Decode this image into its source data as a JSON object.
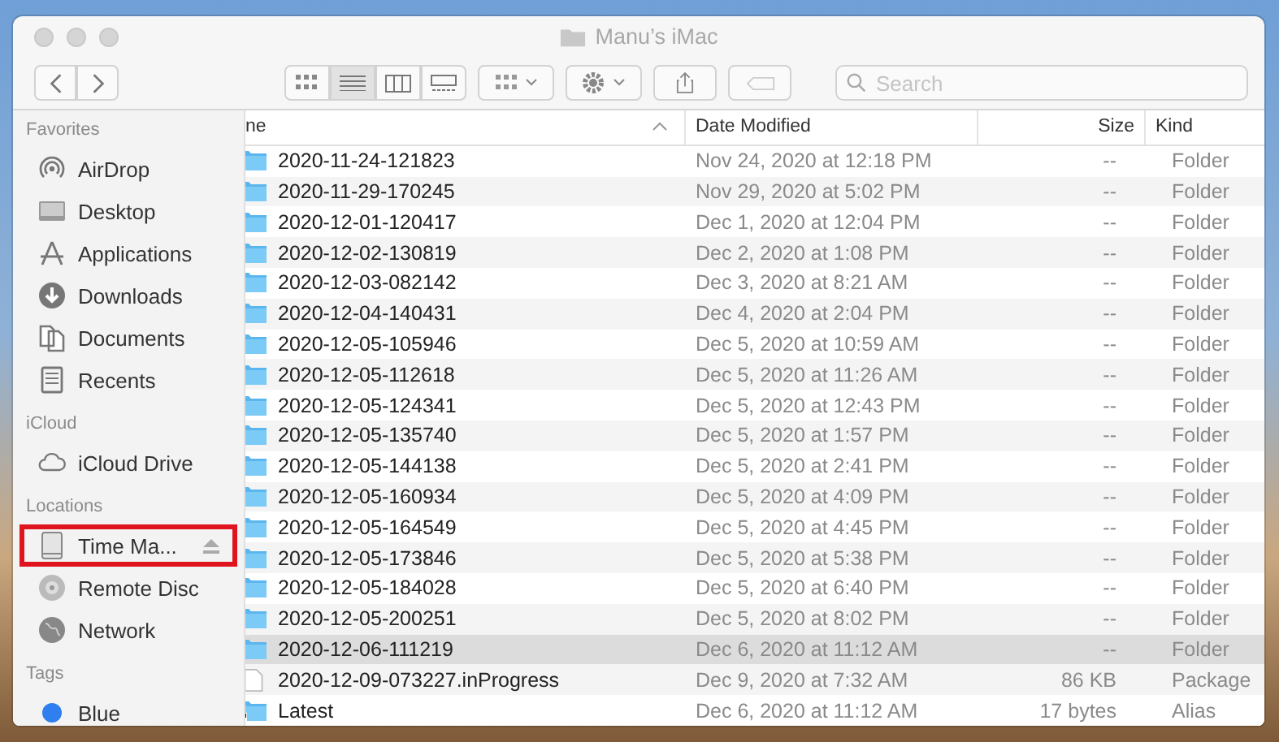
{
  "window": {
    "title": "Manu’s iMac"
  },
  "toolbar": {
    "view_modes": [
      {
        "kind": "icons",
        "selected": false
      },
      {
        "kind": "list",
        "selected": true
      },
      {
        "kind": "columns",
        "selected": false
      },
      {
        "kind": "gallery",
        "selected": false
      }
    ],
    "search": {
      "placeholder": "Search"
    }
  },
  "sidebar": {
    "sections": [
      {
        "title": "Favorites",
        "items": [
          {
            "label": "AirDrop",
            "kind": "airdrop",
            "highlighted": false
          },
          {
            "label": "Desktop",
            "kind": "desktop",
            "highlighted": false
          },
          {
            "label": "Applications",
            "kind": "applications",
            "highlighted": false
          },
          {
            "label": "Downloads",
            "kind": "downloads",
            "highlighted": false
          },
          {
            "label": "Documents",
            "kind": "documents",
            "highlighted": false
          },
          {
            "label": "Recents",
            "kind": "recents",
            "highlighted": false
          }
        ]
      },
      {
        "title": "iCloud",
        "items": [
          {
            "label": "iCloud Drive",
            "kind": "cloud",
            "highlighted": false
          }
        ]
      },
      {
        "title": "Locations",
        "items": [
          {
            "label": "Time Ma...",
            "kind": "disk",
            "highlighted": true,
            "eject": true
          },
          {
            "label": "Remote Disc",
            "kind": "disc",
            "highlighted": false
          },
          {
            "label": "Network",
            "kind": "globe",
            "highlighted": false
          }
        ]
      },
      {
        "title": "Tags",
        "items": [
          {
            "label": "Blue",
            "kind": "tag",
            "color": "#2f7ff0",
            "highlighted": false
          }
        ]
      }
    ]
  },
  "table": {
    "columns": [
      {
        "label": "ne",
        "sorted": true
      },
      {
        "label": "Date Modified",
        "sorted": false
      },
      {
        "label": "Size",
        "sorted": false
      },
      {
        "label": "Kind",
        "sorted": false
      }
    ],
    "rows": [
      {
        "kind": "folder",
        "name": "2020-11-24-121823",
        "date": "Nov 24, 2020 at 12:18 PM",
        "size": "--",
        "type": "Folder",
        "selected": false
      },
      {
        "kind": "folder",
        "name": "2020-11-29-170245",
        "date": "Nov 29, 2020 at 5:02 PM",
        "size": "--",
        "type": "Folder",
        "selected": false
      },
      {
        "kind": "folder",
        "name": "2020-12-01-120417",
        "date": "Dec 1, 2020 at 12:04 PM",
        "size": "--",
        "type": "Folder",
        "selected": false
      },
      {
        "kind": "folder",
        "name": "2020-12-02-130819",
        "date": "Dec 2, 2020 at 1:08 PM",
        "size": "--",
        "type": "Folder",
        "selected": false
      },
      {
        "kind": "folder",
        "name": "2020-12-03-082142",
        "date": "Dec 3, 2020 at 8:21 AM",
        "size": "--",
        "type": "Folder",
        "selected": false
      },
      {
        "kind": "folder",
        "name": "2020-12-04-140431",
        "date": "Dec 4, 2020 at 2:04 PM",
        "size": "--",
        "type": "Folder",
        "selected": false
      },
      {
        "kind": "folder",
        "name": "2020-12-05-105946",
        "date": "Dec 5, 2020 at 10:59 AM",
        "size": "--",
        "type": "Folder",
        "selected": false
      },
      {
        "kind": "folder",
        "name": "2020-12-05-112618",
        "date": "Dec 5, 2020 at 11:26 AM",
        "size": "--",
        "type": "Folder",
        "selected": false
      },
      {
        "kind": "folder",
        "name": "2020-12-05-124341",
        "date": "Dec 5, 2020 at 12:43 PM",
        "size": "--",
        "type": "Folder",
        "selected": false
      },
      {
        "kind": "folder",
        "name": "2020-12-05-135740",
        "date": "Dec 5, 2020 at 1:57 PM",
        "size": "--",
        "type": "Folder",
        "selected": false
      },
      {
        "kind": "folder",
        "name": "2020-12-05-144138",
        "date": "Dec 5, 2020 at 2:41 PM",
        "size": "--",
        "type": "Folder",
        "selected": false
      },
      {
        "kind": "folder",
        "name": "2020-12-05-160934",
        "date": "Dec 5, 2020 at 4:09 PM",
        "size": "--",
        "type": "Folder",
        "selected": false
      },
      {
        "kind": "folder",
        "name": "2020-12-05-164549",
        "date": "Dec 5, 2020 at 4:45 PM",
        "size": "--",
        "type": "Folder",
        "selected": false
      },
      {
        "kind": "folder",
        "name": "2020-12-05-173846",
        "date": "Dec 5, 2020 at 5:38 PM",
        "size": "--",
        "type": "Folder",
        "selected": false
      },
      {
        "kind": "folder",
        "name": "2020-12-05-184028",
        "date": "Dec 5, 2020 at 6:40 PM",
        "size": "--",
        "type": "Folder",
        "selected": false
      },
      {
        "kind": "folder",
        "name": "2020-12-05-200251",
        "date": "Dec 5, 2020 at 8:02 PM",
        "size": "--",
        "type": "Folder",
        "selected": false
      },
      {
        "kind": "folder",
        "name": "2020-12-06-111219",
        "date": "Dec 6, 2020 at 11:12 AM",
        "size": "--",
        "type": "Folder",
        "selected": true
      },
      {
        "kind": "file",
        "name": "2020-12-09-073227.inProgress",
        "date": "Dec 9, 2020 at 7:32 AM",
        "size": "86 KB",
        "type": "Package",
        "selected": false
      },
      {
        "kind": "alias",
        "name": "Latest",
        "date": "Dec 6, 2020 at 11:12 AM",
        "size": "17 bytes",
        "type": "Alias",
        "selected": false
      }
    ]
  }
}
